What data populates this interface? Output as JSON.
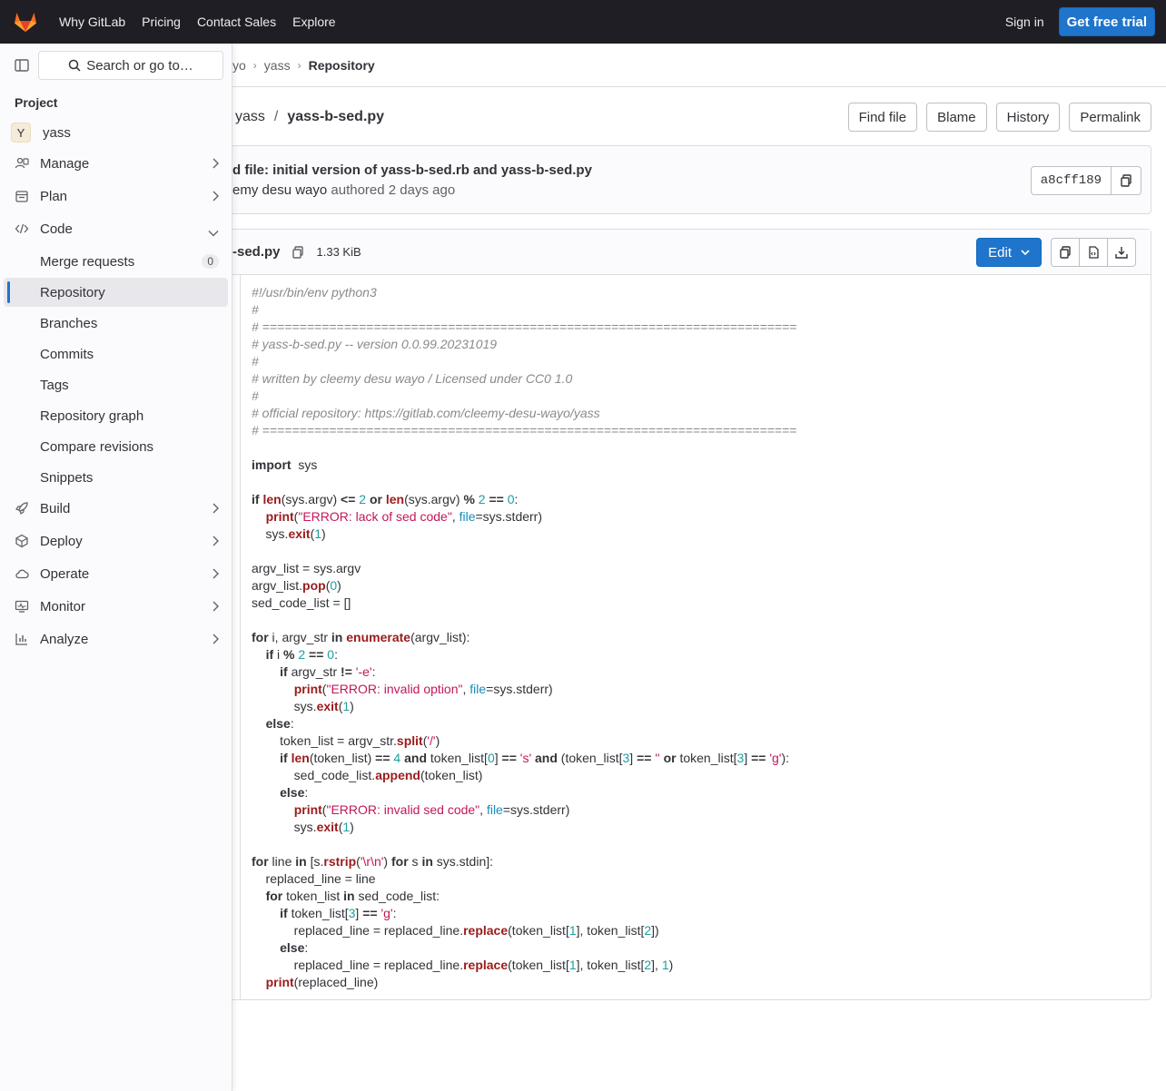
{
  "topbar": {
    "nav": [
      "Why GitLab",
      "Pricing",
      "Contact Sales",
      "Explore"
    ],
    "signin": "Sign in",
    "trial": "Get free trial",
    "brand_color": "#fc6d26"
  },
  "breadcrumb": {
    "items": [
      "yo",
      "yass",
      "Repository"
    ]
  },
  "path": {
    "project": "yass",
    "file": "yass-b-sed.py"
  },
  "path_buttons": [
    "Find file",
    "Blame",
    "History",
    "Permalink"
  ],
  "commit": {
    "title": "d file: initial version of yass-b-sed.rb and yass-b-sed.py",
    "author": "emy desu wayo",
    "authored": "authored",
    "time": "2 days ago",
    "sha": "a8cff189"
  },
  "file": {
    "name": "-sed.py",
    "size": "1.33 KiB",
    "edit_label": "Edit"
  },
  "sidebar": {
    "search_placeholder": "Search or go to…",
    "heading": "Project",
    "project": {
      "avatar": "Y",
      "name": "yass"
    },
    "items": [
      {
        "label": "Manage",
        "icon": "users-icon"
      },
      {
        "label": "Plan",
        "icon": "calendar-icon"
      },
      {
        "label": "Code",
        "icon": "code-icon"
      }
    ],
    "code_sub": [
      {
        "label": "Merge requests",
        "badge": "0"
      },
      {
        "label": "Repository"
      },
      {
        "label": "Branches"
      },
      {
        "label": "Commits"
      },
      {
        "label": "Tags"
      },
      {
        "label": "Repository graph"
      },
      {
        "label": "Compare revisions"
      },
      {
        "label": "Snippets"
      }
    ],
    "items2": [
      {
        "label": "Build",
        "icon": "rocket-icon"
      },
      {
        "label": "Deploy",
        "icon": "deploy-icon"
      },
      {
        "label": "Operate",
        "icon": "cloud-icon"
      },
      {
        "label": "Monitor",
        "icon": "monitor-icon"
      },
      {
        "label": "Analyze",
        "icon": "chart-icon"
      }
    ]
  },
  "code_lines": [
    [
      [
        "cm",
        "#!/usr/bin/env python3"
      ]
    ],
    [
      [
        "cm",
        "#"
      ]
    ],
    [
      [
        "cm",
        "# ========================================================================"
      ]
    ],
    [
      [
        "cm",
        "# yass-b-sed.py -- version 0.0.99.20231019"
      ]
    ],
    [
      [
        "cm",
        "#"
      ]
    ],
    [
      [
        "cm",
        "# written by cleemy desu wayo / Licensed under CC0 1.0"
      ]
    ],
    [
      [
        "cm",
        "#"
      ]
    ],
    [
      [
        "cm",
        "# official repository: https://gitlab.com/cleemy-desu-wayo/yass"
      ]
    ],
    [
      [
        "cm",
        "# ========================================================================"
      ]
    ],
    [],
    [
      [
        "kw",
        "import"
      ],
      [
        "",
        "  sys"
      ]
    ],
    [],
    [
      [
        "kw",
        "if"
      ],
      [
        "",
        " "
      ],
      [
        "bi",
        "len"
      ],
      [
        "",
        "(sys.argv) "
      ],
      [
        "kw",
        "<="
      ],
      [
        "",
        " "
      ],
      [
        "nu",
        "2"
      ],
      [
        "",
        " "
      ],
      [
        "kw",
        "or"
      ],
      [
        "",
        " "
      ],
      [
        "bi",
        "len"
      ],
      [
        "",
        "(sys.argv) "
      ],
      [
        "kw",
        "%"
      ],
      [
        "",
        " "
      ],
      [
        "nu",
        "2"
      ],
      [
        "",
        " "
      ],
      [
        "kw",
        "=="
      ],
      [
        "",
        " "
      ],
      [
        "nu",
        "0"
      ],
      [
        "",
        ":"
      ]
    ],
    [
      [
        "",
        "    "
      ],
      [
        "bi",
        "print"
      ],
      [
        "",
        "("
      ],
      [
        "st",
        "\"ERROR: lack of sed code\""
      ],
      [
        "",
        ", "
      ],
      [
        "kv",
        "file"
      ],
      [
        "",
        "=sys.stderr)"
      ]
    ],
    [
      [
        "",
        "    sys."
      ],
      [
        "bi",
        "exit"
      ],
      [
        "",
        "("
      ],
      [
        "nu",
        "1"
      ],
      [
        "",
        ")"
      ]
    ],
    [],
    [
      [
        "",
        "argv_list = sys.argv"
      ]
    ],
    [
      [
        "",
        "argv_list."
      ],
      [
        "bi",
        "pop"
      ],
      [
        "",
        "("
      ],
      [
        "nu",
        "0"
      ],
      [
        "",
        ")"
      ]
    ],
    [
      [
        "",
        "sed_code_list = []"
      ]
    ],
    [],
    [
      [
        "kw",
        "for"
      ],
      [
        "",
        " i, argv_str "
      ],
      [
        "kw",
        "in"
      ],
      [
        "",
        " "
      ],
      [
        "bi",
        "enumerate"
      ],
      [
        "",
        "(argv_list):"
      ]
    ],
    [
      [
        "",
        "    "
      ],
      [
        "kw",
        "if"
      ],
      [
        "",
        " i "
      ],
      [
        "kw",
        "%"
      ],
      [
        "",
        " "
      ],
      [
        "nu",
        "2"
      ],
      [
        "",
        " "
      ],
      [
        "kw",
        "=="
      ],
      [
        "",
        " "
      ],
      [
        "nu",
        "0"
      ],
      [
        "",
        ":"
      ]
    ],
    [
      [
        "",
        "        "
      ],
      [
        "kw",
        "if"
      ],
      [
        "",
        " argv_str "
      ],
      [
        "kw",
        "!="
      ],
      [
        "",
        " "
      ],
      [
        "st",
        "'-e'"
      ],
      [
        "",
        ":"
      ]
    ],
    [
      [
        "",
        "            "
      ],
      [
        "bi",
        "print"
      ],
      [
        "",
        "("
      ],
      [
        "st",
        "\"ERROR: invalid option\""
      ],
      [
        "",
        ", "
      ],
      [
        "kv",
        "file"
      ],
      [
        "",
        "=sys.stderr)"
      ]
    ],
    [
      [
        "",
        "            sys."
      ],
      [
        "bi",
        "exit"
      ],
      [
        "",
        "("
      ],
      [
        "nu",
        "1"
      ],
      [
        "",
        ")"
      ]
    ],
    [
      [
        "",
        "    "
      ],
      [
        "kw",
        "else"
      ],
      [
        "",
        ":"
      ]
    ],
    [
      [
        "",
        "        token_list = argv_str."
      ],
      [
        "bi",
        "split"
      ],
      [
        "",
        "("
      ],
      [
        "st",
        "'/'"
      ],
      [
        "",
        ")"
      ]
    ],
    [
      [
        "",
        "        "
      ],
      [
        "kw",
        "if"
      ],
      [
        "",
        " "
      ],
      [
        "bi",
        "len"
      ],
      [
        "",
        "(token_list) "
      ],
      [
        "kw",
        "=="
      ],
      [
        "",
        " "
      ],
      [
        "nu",
        "4"
      ],
      [
        "",
        " "
      ],
      [
        "kw",
        "and"
      ],
      [
        "",
        " token_list["
      ],
      [
        "nu",
        "0"
      ],
      [
        "",
        "] "
      ],
      [
        "kw",
        "=="
      ],
      [
        "",
        " "
      ],
      [
        "st",
        "'s'"
      ],
      [
        "",
        " "
      ],
      [
        "kw",
        "and"
      ],
      [
        "",
        " (token_list["
      ],
      [
        "nu",
        "3"
      ],
      [
        "",
        "] "
      ],
      [
        "kw",
        "=="
      ],
      [
        "",
        " "
      ],
      [
        "st",
        "''"
      ],
      [
        "",
        " "
      ],
      [
        "kw",
        "or"
      ],
      [
        "",
        " token_list["
      ],
      [
        "nu",
        "3"
      ],
      [
        "",
        "] "
      ],
      [
        "kw",
        "=="
      ],
      [
        "",
        " "
      ],
      [
        "st",
        "'g'"
      ],
      [
        "",
        "):"
      ]
    ],
    [
      [
        "",
        "            sed_code_list."
      ],
      [
        "bi",
        "append"
      ],
      [
        "",
        "(token_list)"
      ]
    ],
    [
      [
        "",
        "        "
      ],
      [
        "kw",
        "else"
      ],
      [
        "",
        ":"
      ]
    ],
    [
      [
        "",
        "            "
      ],
      [
        "bi",
        "print"
      ],
      [
        "",
        "("
      ],
      [
        "st",
        "\"ERROR: invalid sed code\""
      ],
      [
        "",
        ", "
      ],
      [
        "kv",
        "file"
      ],
      [
        "",
        "=sys.stderr)"
      ]
    ],
    [
      [
        "",
        "            sys."
      ],
      [
        "bi",
        "exit"
      ],
      [
        "",
        "("
      ],
      [
        "nu",
        "1"
      ],
      [
        "",
        ")"
      ]
    ],
    [],
    [
      [
        "kw",
        "for"
      ],
      [
        "",
        " line "
      ],
      [
        "kw",
        "in"
      ],
      [
        "",
        " [s."
      ],
      [
        "bi",
        "rstrip"
      ],
      [
        "",
        "("
      ],
      [
        "st",
        "'\\r\\n'"
      ],
      [
        "",
        ") "
      ],
      [
        "kw",
        "for"
      ],
      [
        "",
        " s "
      ],
      [
        "kw",
        "in"
      ],
      [
        "",
        " sys.stdin]:"
      ]
    ],
    [
      [
        "",
        "    replaced_line = line"
      ]
    ],
    [
      [
        "",
        "    "
      ],
      [
        "kw",
        "for"
      ],
      [
        "",
        " token_list "
      ],
      [
        "kw",
        "in"
      ],
      [
        "",
        " sed_code_list:"
      ]
    ],
    [
      [
        "",
        "        "
      ],
      [
        "kw",
        "if"
      ],
      [
        "",
        " token_list["
      ],
      [
        "nu",
        "3"
      ],
      [
        "",
        "] "
      ],
      [
        "kw",
        "=="
      ],
      [
        "",
        " "
      ],
      [
        "st",
        "'g'"
      ],
      [
        "",
        ":"
      ]
    ],
    [
      [
        "",
        "            replaced_line = replaced_line."
      ],
      [
        "bi",
        "replace"
      ],
      [
        "",
        "(token_list["
      ],
      [
        "nu",
        "1"
      ],
      [
        "",
        "], token_list["
      ],
      [
        "nu",
        "2"
      ],
      [
        "",
        "])"
      ]
    ],
    [
      [
        "",
        "        "
      ],
      [
        "kw",
        "else"
      ],
      [
        "",
        ":"
      ]
    ],
    [
      [
        "",
        "            replaced_line = replaced_line."
      ],
      [
        "bi",
        "replace"
      ],
      [
        "",
        "(token_list["
      ],
      [
        "nu",
        "1"
      ],
      [
        "",
        "], token_list["
      ],
      [
        "nu",
        "2"
      ],
      [
        "",
        "], "
      ],
      [
        "nu",
        "1"
      ],
      [
        "",
        ")"
      ]
    ],
    [
      [
        "",
        "    "
      ],
      [
        "bi",
        "print"
      ],
      [
        "",
        "(replaced_line)"
      ]
    ]
  ]
}
